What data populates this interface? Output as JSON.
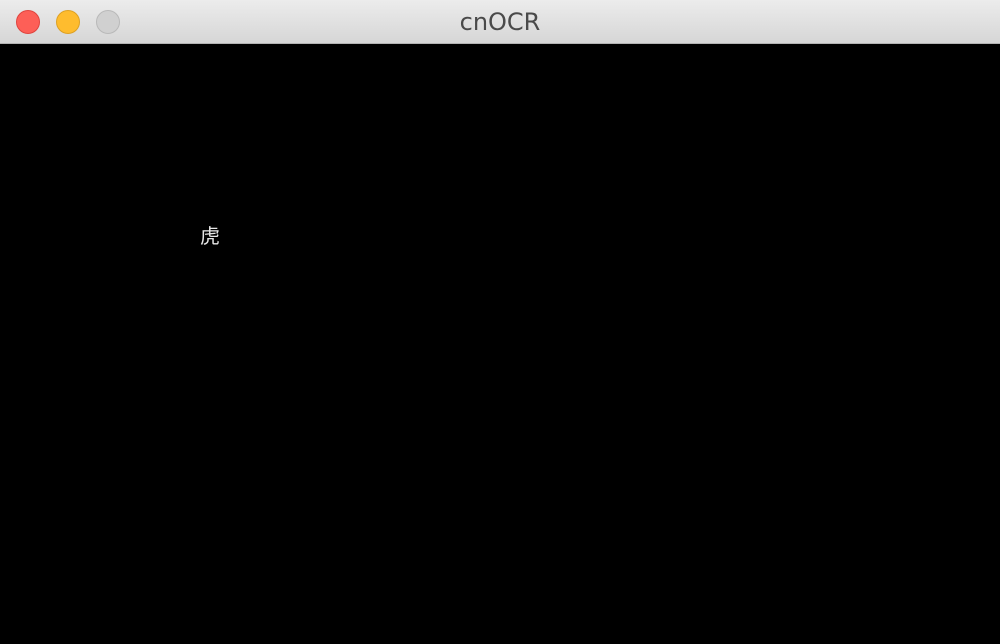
{
  "window": {
    "title": "cnOCR"
  },
  "traffic_lights": {
    "close_icon": "close-icon",
    "minimize_icon": "minimize-icon",
    "zoom_icon": "zoom-icon",
    "colors": {
      "close": "#fd5f57",
      "minimize": "#febc2e",
      "zoom_disabled": "#d0d0d0"
    }
  },
  "canvas": {
    "background": "#000000",
    "character": "虎"
  }
}
